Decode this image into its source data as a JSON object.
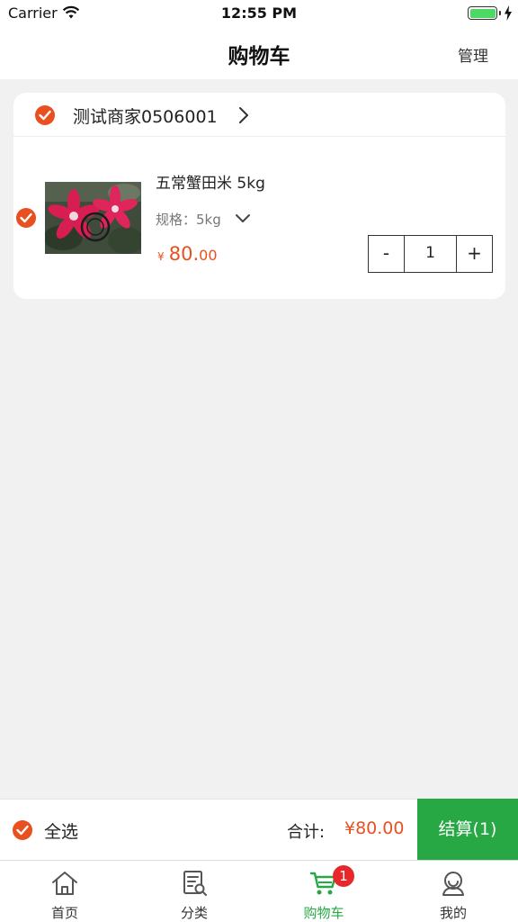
{
  "status_bar": {
    "carrier": "Carrier",
    "time": "12:55 PM"
  },
  "nav": {
    "title": "购物车",
    "manage_label": "管理"
  },
  "shop": {
    "name": "测试商家0506001",
    "item": {
      "name": "五常蟹田米 5kg",
      "spec": "规格：5kg",
      "price_symbol": "¥",
      "price_int": "80.",
      "price_dec": "00",
      "quantity": "1",
      "minus_label": "-",
      "plus_label": "+"
    }
  },
  "checkout": {
    "select_all_label": "全选",
    "total_label": "合计:",
    "total_value": "¥80.00",
    "checkout_button": "结算(1)"
  },
  "tabs": [
    {
      "label": "首页",
      "icon": "home-icon"
    },
    {
      "label": "分类",
      "icon": "category-icon"
    },
    {
      "label": "购物车",
      "icon": "cart-icon",
      "active": true,
      "badge": "1"
    },
    {
      "label": "我的",
      "icon": "profile-icon"
    }
  ],
  "colors": {
    "accent": "#e8501f",
    "green": "#28a745",
    "badge": "#e8272a"
  }
}
